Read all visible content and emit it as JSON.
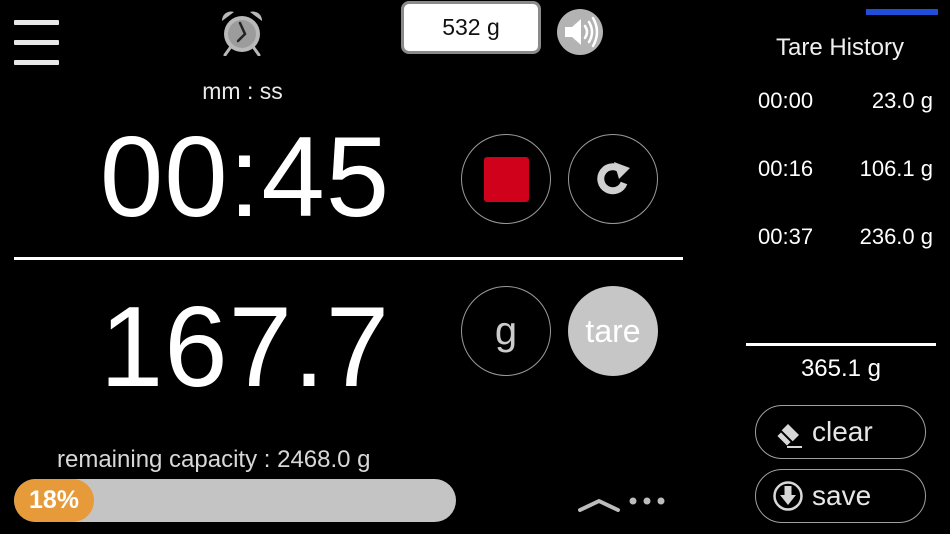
{
  "icons": {
    "menu": "hamburger-menu-icon",
    "alarm": "alarm-clock-icon",
    "speaker": "speaker-volume-icon",
    "stop": "stop-square-icon",
    "reset": "reset-circular-arrow-icon",
    "expand": "chevron-up-icon",
    "more": "more-dots-icon",
    "clear": "eraser-icon",
    "save": "download-arrow-icon"
  },
  "header": {
    "target_weight": "532 g"
  },
  "timer": {
    "format_label": "mm : ss",
    "value": "00:45"
  },
  "scale": {
    "weight": "167.7",
    "unit_label": "g",
    "tare_label": "tare"
  },
  "capacity": {
    "label": "remaining capacity : 2468.0 g",
    "percent_label": "18%",
    "fraction": 0.18
  },
  "history": {
    "title": "Tare History",
    "entries": [
      {
        "time": "00:00",
        "weight": "23.0 g"
      },
      {
        "time": "00:16",
        "weight": "106.1 g"
      },
      {
        "time": "00:37",
        "weight": "236.0 g"
      }
    ],
    "total": "365.1 g",
    "clear_label": "clear",
    "save_label": "save"
  },
  "colors": {
    "stop": "#d0021b",
    "progress": "#e69a3a",
    "indicator": "#1f4fd6"
  }
}
